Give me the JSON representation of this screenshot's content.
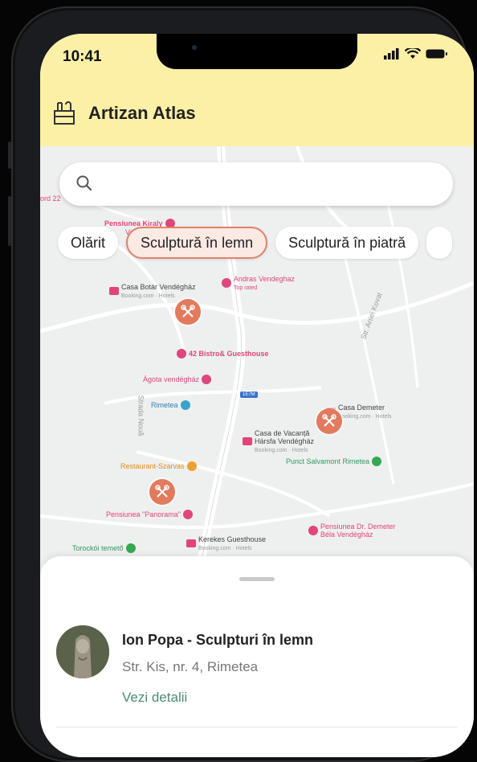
{
  "status_bar": {
    "time": "10:41"
  },
  "header": {
    "app_title": "Artizan Atlas",
    "logo_icon": "workshop-icon"
  },
  "search": {
    "placeholder": "",
    "icon": "search-icon"
  },
  "chips": [
    {
      "label": "Olărit",
      "active": false
    },
    {
      "label": "Sculptură în lemn",
      "active": true
    },
    {
      "label": "Sculptură în piatră",
      "active": false
    }
  ],
  "map": {
    "labels": {
      "p1": "Pensiunea Kiraly",
      "p2": "Ve",
      "p3": "Casa Botár Vendégház",
      "p3s": "Booking.com · Hotels",
      "p4": "Andras Vendeghaz",
      "p4s": "Top rated",
      "p5": "42 Bistro& Guesthouse",
      "p6": "Ágota vendégház",
      "p7": "Rimetea",
      "p8": "Casa Demeter",
      "p8s": "Booking.com · Hotels",
      "p9": "Casa de Vacanță Hársfa Vendégház",
      "p9s": "Booking.com · Hotels",
      "p10": "Restaurant-Szarvas",
      "p11": "Punct Salvamont Rimetea",
      "p12": "Pensiunea \"Panorama\"",
      "p13": "Pensiunea Dr. Demeter Béla Vendégház",
      "p14": "Kerekes Guesthouse",
      "p14s": "Booking.com · Hotels",
      "p15": "Torockói temető",
      "road1": "Strada Nouă",
      "road2": "Str. Aniei Kovat",
      "road3": "ord 22",
      "shield": "1E7M"
    },
    "marker_icon": "tools-cross-icon"
  },
  "sheet": {
    "name": "Ion Popa - Sculpturi în lemn",
    "address": "Str. Kis, nr. 4, Rimetea",
    "details_link": "Vezi detalii"
  },
  "colors": {
    "header": "#fbf0a6",
    "accent": "#e27a5e",
    "link": "#4f8a76"
  }
}
